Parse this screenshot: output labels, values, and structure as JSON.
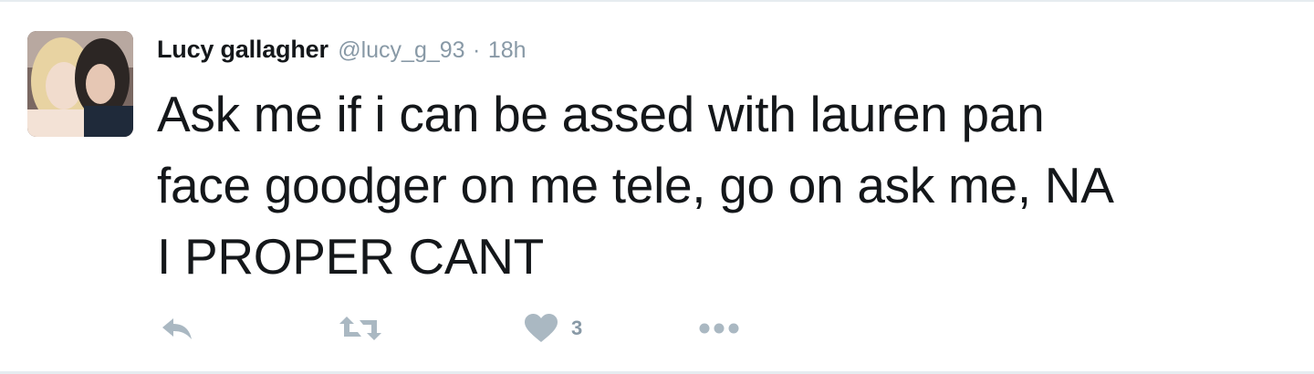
{
  "tweet": {
    "author": {
      "name": "Lucy gallagher",
      "handle": "@lucy_g_93",
      "separator": "·",
      "time": "18h",
      "avatar_icon": "avatar-photo"
    },
    "text_lines": [
      "Ask me if i can be assed with lauren pan",
      "face goodger on me tele, go on ask me, NA",
      "I PROPER CANT"
    ],
    "actions": {
      "reply_icon": "reply-icon",
      "retweet_icon": "retweet-icon",
      "like_icon": "heart-icon",
      "like_count": "3",
      "more_icon": "more-dots-icon"
    },
    "colors": {
      "text": "#14171a",
      "muted": "#8899a6",
      "icon": "#aab8c2",
      "border": "#e6ecf0"
    }
  }
}
